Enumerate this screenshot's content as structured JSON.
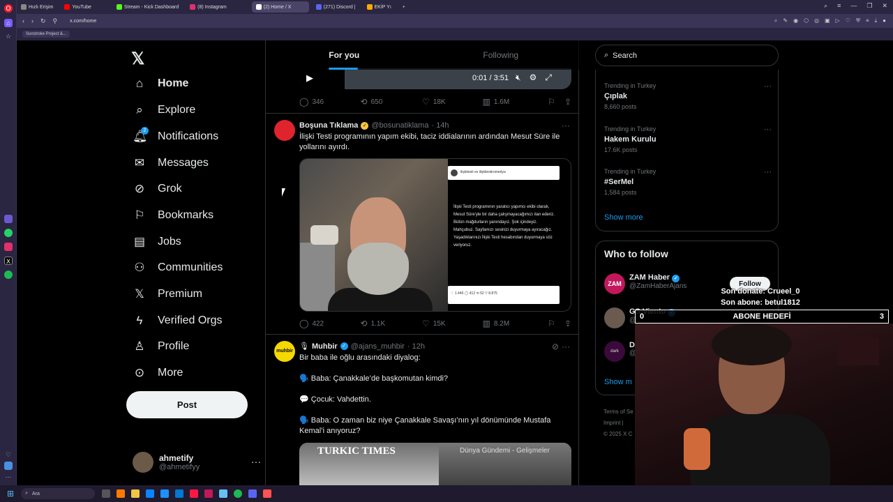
{
  "browser": {
    "tabs": [
      {
        "label": "Hızlı Erişim",
        "color": "#888888"
      },
      {
        "label": "YouTube",
        "color": "#ff0000"
      },
      {
        "label": "Stream - Kick Dashboard",
        "color": "#53fc18"
      },
      {
        "label": "(8) Instagram",
        "color": "#e1306c"
      },
      {
        "label": "(2) Home / X",
        "color": "#ffffff"
      },
      {
        "label": "(271) Discord |",
        "color": "#5865f2"
      },
      {
        "label": "EKİP Yı",
        "color": "#ffaa00"
      }
    ],
    "url": "x.com/home",
    "bookmark": "Sunstroke Project &...",
    "new_tab": "+"
  },
  "nav": {
    "home": "Home",
    "explore": "Explore",
    "notifications": "Notifications",
    "notifications_badge": "2",
    "messages": "Messages",
    "grok": "Grok",
    "bookmarks": "Bookmarks",
    "jobs": "Jobs",
    "communities": "Communities",
    "premium": "Premium",
    "verified_orgs": "Verified Orgs",
    "profile": "Profile",
    "more": "More",
    "post_button": "Post"
  },
  "account": {
    "name": "ahmetify",
    "handle": "@ahmetifyy",
    "more": "···"
  },
  "feed": {
    "tab_for_you": "For you",
    "tab_following": "Following",
    "video": {
      "time": "0:01 / 3:51",
      "progress": 0.004
    },
    "post0_actions": {
      "replies": "346",
      "reposts": "650",
      "likes": "18K",
      "views": "1.6M"
    },
    "post1": {
      "name": "Boşuna Tıklama",
      "handle": "@bosunatiklama",
      "time": "· 14h",
      "text": "İlişki Testi programının yapım ekibi, taciz iddialarının ardından Mesut Süre ile yollarını ayırdı.",
      "card_account": "ilişkitesti ve ilişkitestiromedya",
      "card_text": "İlişki Testi programının yaratıcı yapımcı ekibi olarak, Mesut Süre'yle bir daha çalışmayacağımızı ilan ederiz. Bütün mağdurların yanındayız. Şok içindeyiz. Mahçubuz. Sayfamızı sesinizi duyurmaya ayıracağız. Yaşadıklarınızı İlişki Testi hesabından duyurmaya söz veriyoruz.",
      "card_stats": "♡ 1.445   ◯ 412   ⟲ 52   ▽ 8.875",
      "replies": "422",
      "reposts": "1.1K",
      "likes": "15K",
      "views": "8.2M",
      "more": "···"
    },
    "post2": {
      "name": "Muhbir",
      "handle": "@ajans_muhbir",
      "time": "· 12h",
      "avatar_text": "muhbir",
      "line1": "Bir baba ile oğlu arasındaki diyalog:",
      "line2": "🗣️ Baba: Çanakkale’de başkomutan kimdi?",
      "line3": "💬 Çocuk: Vahdettin.",
      "line4": "🗣️ Baba: O zaman biz niye Çanakkale Savaşı’nın yıl dönümünde Mustafa Kemal’i anıyoruz?",
      "media_logo": "TURKIC TIMES",
      "media_caption": "Dünya Gündemi - Gelişmeler",
      "more": "···"
    }
  },
  "right": {
    "search_placeholder": "Search",
    "trends": [
      {
        "context": "Trending in Turkey",
        "name": "Çıplak",
        "count": "8,660 posts"
      },
      {
        "context": "Trending in Turkey",
        "name": "Hakem Kurulu",
        "count": "17.6K posts"
      },
      {
        "context": "Trending in Turkey",
        "name": "#SerMel",
        "count": "1,584 posts"
      }
    ],
    "show_more": "Show more",
    "who_to_follow": "Who to follow",
    "suggestions": [
      {
        "name": "ZAM Haber",
        "handle": "@ZamHaberAjans",
        "avatar_text": "ZAM",
        "color": "#c2185b"
      },
      {
        "name": "GS Viento",
        "handle": "@",
        "avatar_text": "",
        "color": "#6a5a50"
      },
      {
        "name": "D",
        "handle": "@",
        "avatar_text": "dark",
        "color": "#3a0a3a"
      }
    ],
    "follow": "Follow",
    "wtf_show_more": "Show m",
    "footer_line1": "Terms of Se",
    "footer_line2": "Imprint  |",
    "footer_line3": "© 2025 X C"
  },
  "overlay": {
    "last_donate": "Son donate: Crueel_0",
    "last_sub": "Son abone: betul1812",
    "goal_label": "ABONE HEDEFİ",
    "goal_current": "0",
    "goal_target": "3"
  },
  "taskbar": {
    "search_placeholder": "Ara",
    "apps": [
      "#555555",
      "#ff7a00",
      "#f4c542",
      "#0a84ff",
      "#1e90ff",
      "#0078d4",
      "#ff1744",
      "#c2185b",
      "#66c0f4",
      "#1db954",
      "#5865f2",
      "#ff5252"
    ]
  },
  "colors": {
    "accent": "#1d9bf0",
    "verified_gold": "#f4c542",
    "verified_blue": "#1d9bf0"
  }
}
